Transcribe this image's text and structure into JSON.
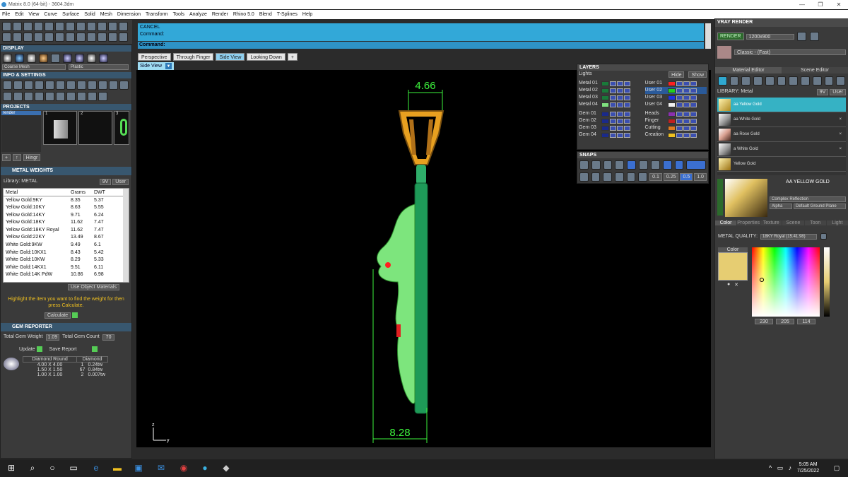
{
  "window": {
    "title": "Matrix 8.0 (64-bit) - 3604.3dm",
    "controls": [
      "—",
      "❐",
      "✕"
    ]
  },
  "menu": [
    "File",
    "Edit",
    "View",
    "Curve",
    "Surface",
    "Solid",
    "Mesh",
    "Dimension",
    "Transform",
    "Tools",
    "Analyze",
    "Render",
    "Rhino 5.0",
    "Blend",
    "T-Splines",
    "Help"
  ],
  "left": {
    "display_header": "DISPLAY",
    "display_modes": [
      "Coarse Mesh",
      "Plastic"
    ],
    "info_header": "INFO & SETTINGS",
    "projects_header": "PROJECTS",
    "projects_item": "render",
    "project_thumbs": [
      "1",
      "2",
      "3"
    ],
    "hinge_label": "Hingr",
    "metal_weights": {
      "header": "METAL WEIGHTS",
      "library_label": "Library: METAL",
      "units": [
        "9V",
        "User"
      ],
      "columns": [
        "Metal",
        "Grams",
        "DWT"
      ],
      "rows": [
        [
          "Yellow Gold:9KY",
          "8.35",
          "5.37"
        ],
        [
          "Yellow Gold:10KY",
          "8.63",
          "5.55"
        ],
        [
          "Yellow Gold:14KY",
          "9.71",
          "6.24"
        ],
        [
          "Yellow Gold:18KY",
          "11.62",
          "7.47"
        ],
        [
          "Yellow Gold:18KY Royal",
          "11.62",
          "7.47"
        ],
        [
          "Yellow Gold:22KY",
          "13.49",
          "8.67"
        ],
        [
          "White Gold:9KW",
          "9.49",
          "6.1"
        ],
        [
          "White Gold:10KX1",
          "8.43",
          "5.42"
        ],
        [
          "White Gold:10KW",
          "8.29",
          "5.33"
        ],
        [
          "White Gold:14KX1",
          "9.51",
          "6.11"
        ],
        [
          "White Gold:14K PdW",
          "10.86",
          "6.98"
        ]
      ],
      "use_object_materials": "Use Object Materials",
      "hint": "Highlight the item you want to find the weight for then press Calculate.",
      "calculate": "Calculate"
    },
    "gem_reporter": {
      "header": "GEM REPORTER",
      "total_weight_label": "Total Gem Weight",
      "total_weight_value": "1.09",
      "total_count_label": "Total Gem Count",
      "total_count_value": "70",
      "update": "Update",
      "save_report": "Save Report",
      "columns": [
        "Diamond Round",
        "Diamond"
      ],
      "rows": [
        [
          "4.00 X 4.00",
          "1",
          "0.24tw"
        ],
        [
          "1.50 X 1.50",
          "67",
          "0.84tw"
        ],
        [
          "1.00 X 1.00",
          "2",
          "0.007tw"
        ]
      ]
    }
  },
  "command": {
    "line1": "CANCEL",
    "line2": "Command:",
    "prompt": "Command:"
  },
  "viewport": {
    "tabs": [
      "Perspective",
      "Through Finger",
      "Side View",
      "Looking Down",
      "+"
    ],
    "active_tab": "Side View",
    "view_label": "Side View",
    "dim_top": "4.66",
    "dim_bottom": "8.28",
    "axis_z": "z",
    "axis_y": "y"
  },
  "layers": {
    "header": "LAYERS",
    "lights": "Lights",
    "hide": "Hide",
    "show": "Show",
    "left": [
      {
        "name": "Metal 01",
        "color": "#1a7a3a"
      },
      {
        "name": "Metal 02",
        "color": "#1a7a3a"
      },
      {
        "name": "Metal 03",
        "color": "#1a7a3a"
      },
      {
        "name": "Metal 04",
        "color": "#7fe07f"
      },
      {
        "name": "Gem 01",
        "color": "#1a2a8a"
      },
      {
        "name": "Gem 02",
        "color": "#1a2a8a"
      },
      {
        "name": "Gem 03",
        "color": "#1a2a8a"
      },
      {
        "name": "Gem 04",
        "color": "#1a2a8a"
      }
    ],
    "right": [
      {
        "name": "User 01",
        "color": "#ff2020"
      },
      {
        "name": "User 02",
        "color": "#20d020"
      },
      {
        "name": "User 03",
        "color": "#2030e0"
      },
      {
        "name": "User 04",
        "color": "#f0f0f0"
      },
      {
        "name": "Heads",
        "color": "#8a30b0"
      },
      {
        "name": "Finger",
        "color": "#c02020"
      },
      {
        "name": "Cutting",
        "color": "#e07a20"
      },
      {
        "name": "Creation",
        "color": "#f0c020"
      }
    ]
  },
  "snaps": {
    "header": "SNAPS",
    "values": [
      "0.1",
      "0.25",
      "0.5",
      "1.0"
    ]
  },
  "vray": {
    "header": "VRAY RENDER",
    "render": "RENDER",
    "resolution": "1200x900",
    "preset": "Classic - (Fast)",
    "tabs": [
      "Material Editor",
      "Scene Editor"
    ],
    "library": "LIBRARY: Metal",
    "units": [
      "9V",
      "User"
    ],
    "materials": [
      "aa Yellow Gold",
      "aa White Gold",
      "aa Rose Gold",
      "a White Gold",
      "Yellow Gold"
    ],
    "selected": "AA YELLOW GOLD",
    "reflection": "Complex Reflection",
    "alpha": "Alpha",
    "ground": "Default Ground Plane",
    "prop_tabs": [
      "Color",
      "Properties",
      "Texture",
      "Scene",
      "Toon",
      "Light"
    ],
    "metal_quality_label": "METAL QUALITY:",
    "metal_quality_value": "18KY Royal (15.41.98)",
    "color_label": "Color",
    "rgb": [
      "230",
      "205",
      "114"
    ],
    "swatch_color": "#e6cd72"
  },
  "taskbar": {
    "time": "5:05 AM",
    "date": "7/25/2022"
  }
}
